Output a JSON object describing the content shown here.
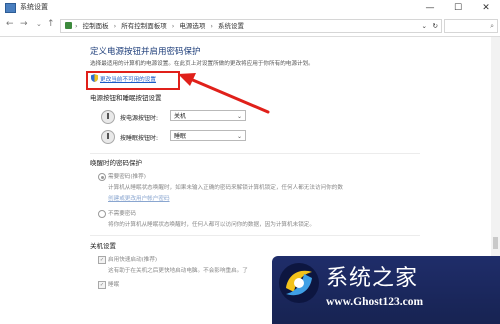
{
  "window": {
    "title": "系统设置",
    "min_label": "—",
    "max_label": "☐",
    "close_label": "✕"
  },
  "address": {
    "back": "←",
    "forward": "→",
    "up": "↑",
    "breadcrumbs": [
      "控制面板",
      "所有控制面板项",
      "电源选项",
      "系统设置"
    ],
    "separator": "›",
    "dropdown": "⌄",
    "refresh": "↻",
    "search_icon": "⌕"
  },
  "main": {
    "heading": "定义电源按钮并启用密码保护",
    "description": "选择最适用的计算机的电源设置。在此页上对设置所做的更改将应用于你所有的电源计划。",
    "change_link": "更改当前不可用的设置",
    "power_section": {
      "title": "电源按钮和睡眠按钮设置",
      "power_button_label": "按电源按钮时:",
      "power_button_value": "关机",
      "sleep_button_label": "按睡眠按钮时:",
      "sleep_button_value": "睡眠"
    },
    "wake_section": {
      "title": "唤醒时的密码保护",
      "require_password_label": "需要密码(推荐)",
      "require_password_desc": "计算机从睡眠状态唤醒时，如果未输入正确的密码来解锁计算机锁定，任何人都无法访问你的数",
      "create_password_link": "创建或更改用户帐户密码",
      "no_password_label": "不需要密码",
      "no_password_desc": "将你的计算机从睡眠状态唤醒时，任何人都可以访问你的数据，因为计算机未锁定。"
    },
    "shutdown_section": {
      "title": "关机设置",
      "fast_startup_label": "启用快速启动(推荐)",
      "fast_startup_desc": "这有助于在关机之后更快地启动电脑。不会影响重启。了",
      "sleep_label": "睡眠"
    }
  },
  "watermark": {
    "title": "系统之家",
    "url": "www.Ghost123.com"
  },
  "colors": {
    "heading": "#1e3e7a",
    "link": "#1a5bc6",
    "highlight": "#e0201a",
    "watermark_bg": "#1f2d6a"
  }
}
